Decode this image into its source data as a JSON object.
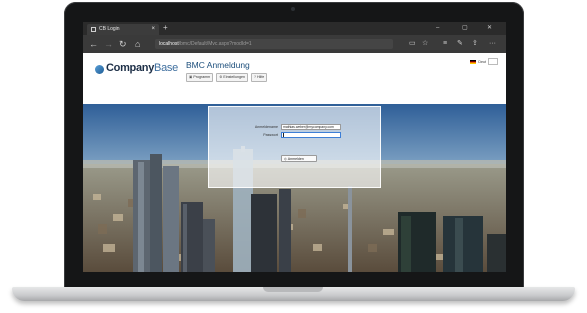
{
  "browser": {
    "tab_title": "CB Login",
    "tab_close": "×",
    "new_tab": "+",
    "url_host": "localhost",
    "url_path": "/bmc/Default/Mvc.aspx?modId=1",
    "window_controls": [
      "–",
      "▢",
      "✕"
    ],
    "nav_icons": {
      "back": "back-arrow-icon",
      "forward": "forward-arrow-icon",
      "refresh": "refresh-icon",
      "home": "home-icon"
    },
    "toolbar_icons": [
      "reading-view-icon",
      "favorite-star-icon",
      "hub-icon",
      "notes-icon",
      "share-icon",
      "more-icon"
    ]
  },
  "header": {
    "logo_brand_bold": "Company",
    "logo_brand_light": "Base",
    "app_title": "BMC Anmeldung",
    "menu": [
      {
        "label": "Programm",
        "icon": "program-icon"
      },
      {
        "label": "Einstellungen",
        "icon": "settings-icon"
      },
      {
        "label": "Hilfe",
        "icon": "help-icon"
      }
    ],
    "language": {
      "label": "Deut",
      "flag": "germany-flag-icon"
    }
  },
  "login": {
    "username_label": "Anmeldename",
    "username_value": "mathias.weber@mycompany.com",
    "password_label": "Passwort",
    "password_value": "",
    "submit_label": "Anmelden",
    "submit_icon": "login-icon"
  },
  "colors": {
    "browser_chrome": "#2b2b2b",
    "accent_title": "#1d4f7c",
    "focus_border": "#3d7ed6"
  }
}
